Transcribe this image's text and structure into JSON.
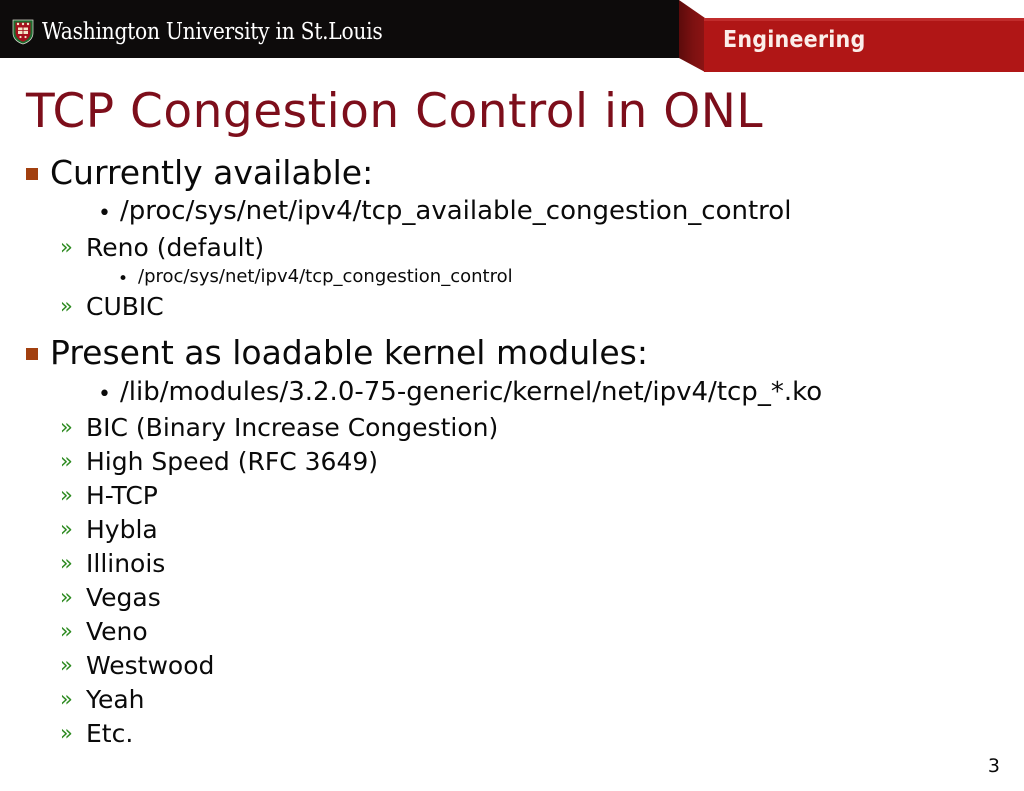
{
  "header": {
    "university_name": "Washington University in St.Louis",
    "school_banner": "Engineering",
    "logo_icon": "washu-shield-icon",
    "colors": {
      "bar_black": "#0d0b0b",
      "banner_red": "#b01616",
      "bevel_dark_red": "#5c0b0b"
    }
  },
  "title": "TCP Congestion Control in ONL",
  "title_color": "#7d0e1b",
  "bullet_colors": {
    "square": "#a2400f",
    "chevron": "#2e8b21",
    "text": "#0a0a0a"
  },
  "sections": [
    {
      "heading": "Currently available:",
      "items": [
        {
          "level": 2,
          "marker": "bullet-dot",
          "text": "/proc/sys/net/ipv4/tcp_available_congestion_control"
        },
        {
          "level": "2b",
          "marker": "chevron-double-right",
          "text": "Reno (default)"
        },
        {
          "level": 3,
          "marker": "bullet-dot-small",
          "text": "/proc/sys/net/ipv4/tcp_congestion_control"
        },
        {
          "level": "2b",
          "marker": "chevron-double-right",
          "text": "CUBIC"
        }
      ]
    },
    {
      "heading": "Present as loadable kernel modules:",
      "items": [
        {
          "level": 2,
          "marker": "bullet-dot",
          "text": "/lib/modules/3.2.0-75-generic/kernel/net/ipv4/tcp_*.ko"
        },
        {
          "level": "2b",
          "marker": "chevron-double-right",
          "text": "BIC (Binary Increase Congestion)"
        },
        {
          "level": "2b",
          "marker": "chevron-double-right",
          "text": "High Speed (RFC 3649)"
        },
        {
          "level": "2b",
          "marker": "chevron-double-right",
          "text": "H-TCP"
        },
        {
          "level": "2b",
          "marker": "chevron-double-right",
          "text": "Hybla"
        },
        {
          "level": "2b",
          "marker": "chevron-double-right",
          "text": "Illinois"
        },
        {
          "level": "2b",
          "marker": "chevron-double-right",
          "text": "Vegas"
        },
        {
          "level": "2b",
          "marker": "chevron-double-right",
          "text": "Veno"
        },
        {
          "level": "2b",
          "marker": "chevron-double-right",
          "text": "Westwood"
        },
        {
          "level": "2b",
          "marker": "chevron-double-right",
          "text": "Yeah"
        },
        {
          "level": "2b",
          "marker": "chevron-double-right",
          "text": "Etc."
        }
      ]
    }
  ],
  "page_number": "3",
  "glyphs": {
    "dot": "•",
    "chevron": "»"
  }
}
